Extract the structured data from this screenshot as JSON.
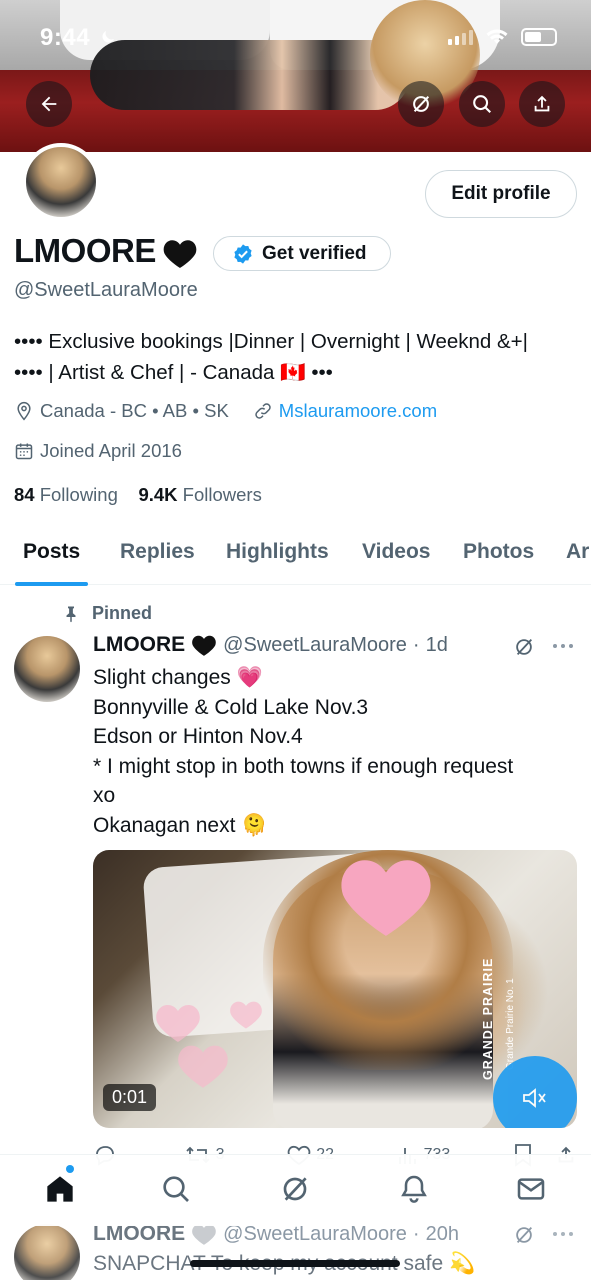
{
  "status_bar": {
    "time": "9:44"
  },
  "profile": {
    "name": "LMOORE",
    "name_emoji": "🖤",
    "verify_label": "Get verified",
    "handle": "@SweetLauraMoore",
    "edit_label": "Edit profile",
    "bio_line1": "•••• Exclusive bookings |Dinner | Overnight | Weeknd &+|",
    "bio_line2": "•••• | Artist & Chef | - Canada 🇨🇦 •••",
    "location": "Canada - BC • AB • SK",
    "website": "Mslauramoore.com",
    "joined": "Joined April 2016",
    "following_count": "84",
    "following_label": "Following",
    "followers_count": "9.4K",
    "followers_label": "Followers"
  },
  "tabs": [
    {
      "label": "Posts",
      "active": true
    },
    {
      "label": "Replies"
    },
    {
      "label": "Highlights"
    },
    {
      "label": "Videos"
    },
    {
      "label": "Photos"
    },
    {
      "label": "Ar"
    }
  ],
  "pinned_post": {
    "pinned_label": "Pinned",
    "name": "LMOORE",
    "name_emoji": "🖤",
    "handle": "@SweetLauraMoore",
    "sep": "·",
    "time": "1d",
    "lines": [
      "Slight changes 💗",
      "Bonnyville & Cold Lake Nov.3",
      "Edson or Hinton Nov.4",
      "* I might stop in both towns if enough request",
      "xo",
      "Okanagan next 🫠"
    ],
    "media": {
      "duration": "0:01",
      "overlay_title": "GRANDE PRAIRIE",
      "overlay_sub": "Grande Prairie No. 1"
    },
    "actions": {
      "replies": "",
      "reposts": "3",
      "likes": "22",
      "views": "733"
    }
  },
  "second_post": {
    "name": "LMOORE",
    "name_emoji": "🤍",
    "handle": "@SweetLauraMoore",
    "sep": "·",
    "time": "20h",
    "text": "SNAPCHAT To keep my account safe 💫"
  },
  "colors": {
    "accent": "#1d9bf0",
    "text": "#0f1419",
    "secondary": "#536471",
    "border": "#cfd9de"
  }
}
